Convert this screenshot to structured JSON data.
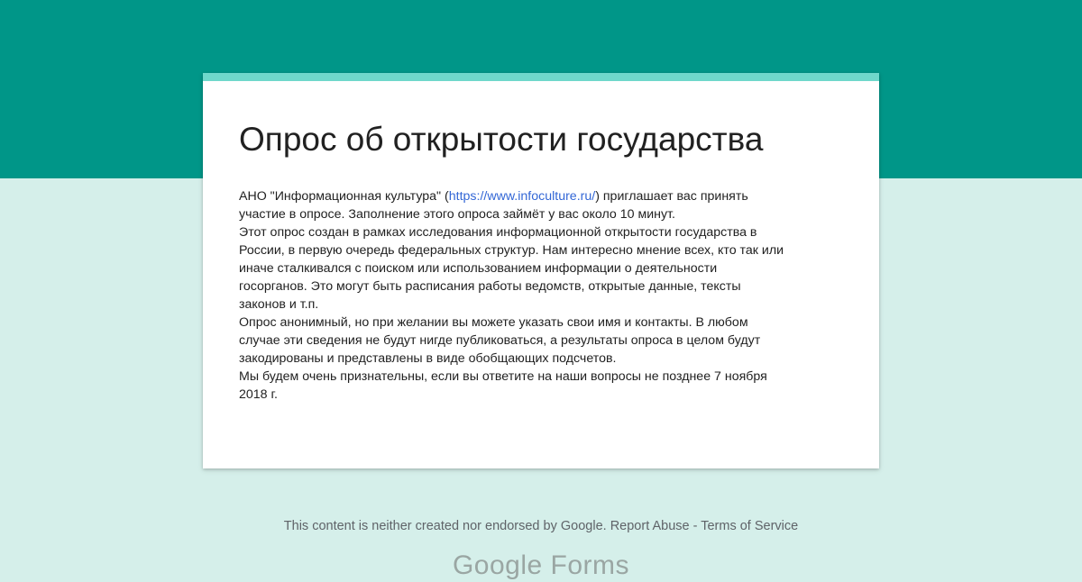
{
  "header": {
    "band_color": "#009688"
  },
  "form": {
    "accent_color": "#6fd8cb",
    "title": "Опрос об открытости государства",
    "description": {
      "line1_pre": "АНО \"Информационная культура\" (",
      "link": "https://www.infoculture.ru/",
      "line1_post": ") приглашает вас принять",
      "lines": [
        "участие в опросе. Заполнение этого опроса займёт у вас около 10 минут.",
        "Этот опрос создан в рамках исследования информационной открытости государства в",
        "России, в первую очередь федеральных структур. Нам интересно мнение всех, кто так или",
        "иначе сталкивался с поиском или использованием информации о деятельности",
        "госорганов. Это могут быть расписания работы ведомств,  открытые данные, тексты",
        "законов и т.п.",
        "Опрос анонимный, но при желании вы можете указать свои имя и контакты. В любом",
        "случае эти сведения не будут нигде публиковаться, а результаты опроса в целом будут",
        "закодированы и представлены в виде обобщающих подсчетов.",
        "Мы будем очень признательны, если вы ответите на наши вопросы не позднее 7 ноября",
        "2018 г."
      ]
    }
  },
  "footer": {
    "disclaimer": "This content is neither created nor endorsed by Google.",
    "report_abuse": "Report Abuse",
    "separator": "-",
    "terms": "Terms of Service",
    "logo_text": "Google Forms"
  }
}
